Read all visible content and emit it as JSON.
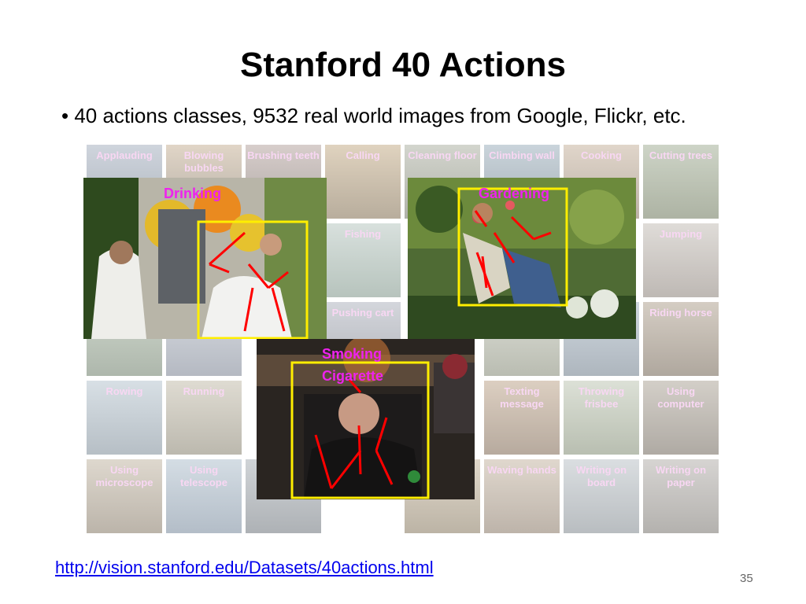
{
  "slide": {
    "title": "Stanford 40 Actions",
    "bullet": "• 40 actions classes, 9532 real world images from Google, Flickr, etc.",
    "url": "http://vision.stanford.edu/Datasets/40actions.html",
    "page_number": "35"
  },
  "grid_labels": {
    "applauding": "Applauding",
    "blowing_bubbles": "Blowing bubbles",
    "brushing_teeth": "Brushing teeth",
    "calling": "Calling",
    "cleaning_floor": "Cleaning floor",
    "climbing_wall": "Climbing wall",
    "cooking": "Cooking",
    "cutting_trees": "Cutting trees",
    "fishing": "Fishing",
    "jumping": "Jumping",
    "pushing_cart": "Pushing cart",
    "riding_horse": "Riding horse",
    "rowing": "Rowing",
    "running": "Running",
    "texting_message": "Texting message",
    "throwing_frisbee": "Throwing frisbee",
    "using_computer": "Using computer",
    "using_microscope": "Using microscope",
    "using_telescope": "Using telescope",
    "waving_hands": "Waving hands",
    "writing_on_board": "Writing on board",
    "writing_on_paper": "Writing on paper"
  },
  "featured": {
    "drinking": "Drinking",
    "gardening": "Gardening",
    "smoking": "Smoking\nCigarette"
  },
  "colors": {
    "label_magenta": "#ee22ee",
    "bbox_yellow": "#ffee00",
    "pose_red": "#ff0000",
    "link_blue": "#0000ee"
  }
}
